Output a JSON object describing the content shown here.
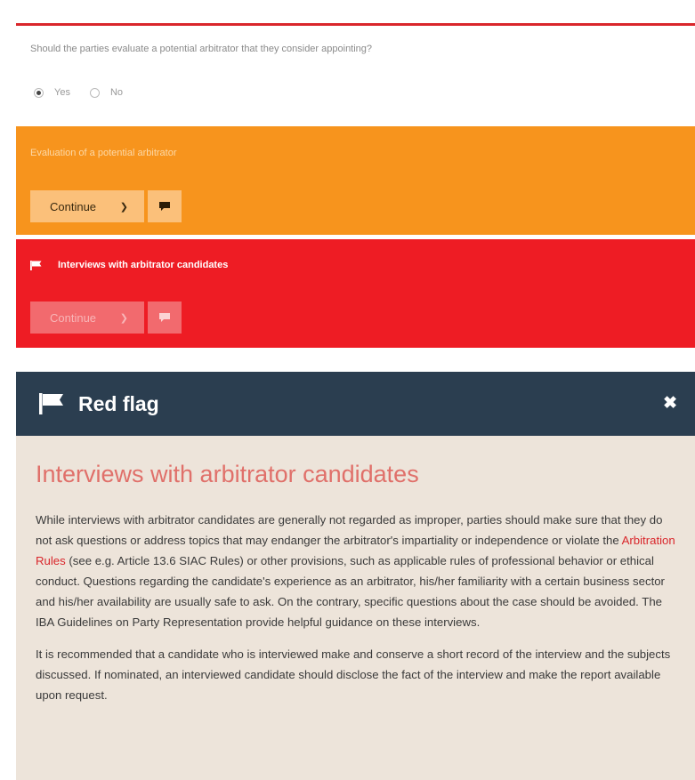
{
  "question": {
    "text": "Should the parties evaluate a potential arbitrator that they consider appointing?",
    "options": [
      {
        "label": "Yes",
        "checked": true
      },
      {
        "label": "No",
        "checked": false
      }
    ]
  },
  "steps": [
    {
      "title": "Evaluation of a potential arbitrator",
      "color": "#f7941d",
      "continue_label": "Continue"
    },
    {
      "title": "Interviews with arbitrator candidates",
      "color": "#ee1c24",
      "continue_label": "Continue",
      "flagged": true
    }
  ],
  "modal": {
    "header_title": "Red flag",
    "close_icon": "close-icon",
    "heading": "Interviews with arbitrator candidates",
    "para1": {
      "before_link": "While interviews with arbitrator candidates are generally not regarded as improper, parties should make sure that they do not ask questions or address topics that may endanger the arbitrator's impartiality or independence or violate the ",
      "link": "Arbitration Rules",
      "after_link": " (see e.g. Article 13.6 SIAC Rules) or other provisions, such as applicable rules of professional behavior or ethical conduct. Questions regarding the candidate's experience as an arbitrator, his/her familiarity with a certain business sector and his/her availability are usually safe to ask. On the contrary, specific questions about the case should be avoided. The IBA Guidelines on Party Representation provide helpful guidance on these interviews."
    },
    "para2": "It is recommended that a candidate who is interviewed make and conserve a short record of the interview and the subjects discussed. If nominated, an interviewed candidate should disclose the fact of the interview and make the report available upon request."
  },
  "colors": {
    "accent_red": "#d9262b",
    "orange": "#f7941d",
    "red": "#ee1c24",
    "navy": "#2b3e50",
    "beige": "#ede4da"
  }
}
